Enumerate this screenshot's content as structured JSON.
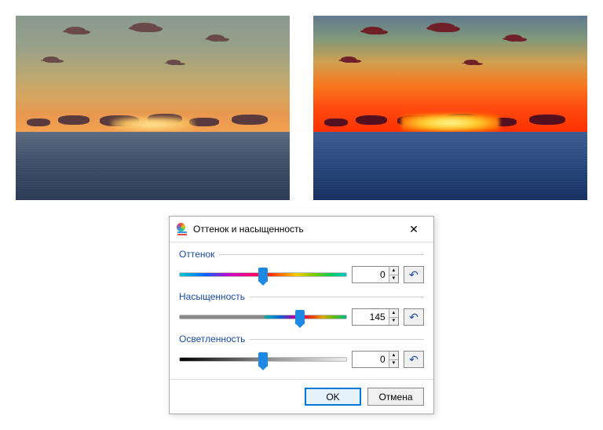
{
  "images": {
    "left_desc": "original-sunset",
    "right_desc": "saturated-sunset"
  },
  "dialog": {
    "title": "Оттенок и насыщенность",
    "close_glyph": "✕",
    "hue": {
      "label": "Оттенок",
      "value": "0",
      "percent": 50
    },
    "saturation": {
      "label": "Насыщенность",
      "value": "145",
      "percent": 72
    },
    "lightness": {
      "label": "Осветленность",
      "value": "0",
      "percent": 50
    },
    "reset_glyph": "↶",
    "spin_up": "▲",
    "spin_down": "▼",
    "ok_label": "OK",
    "cancel_label": "Отмена"
  }
}
